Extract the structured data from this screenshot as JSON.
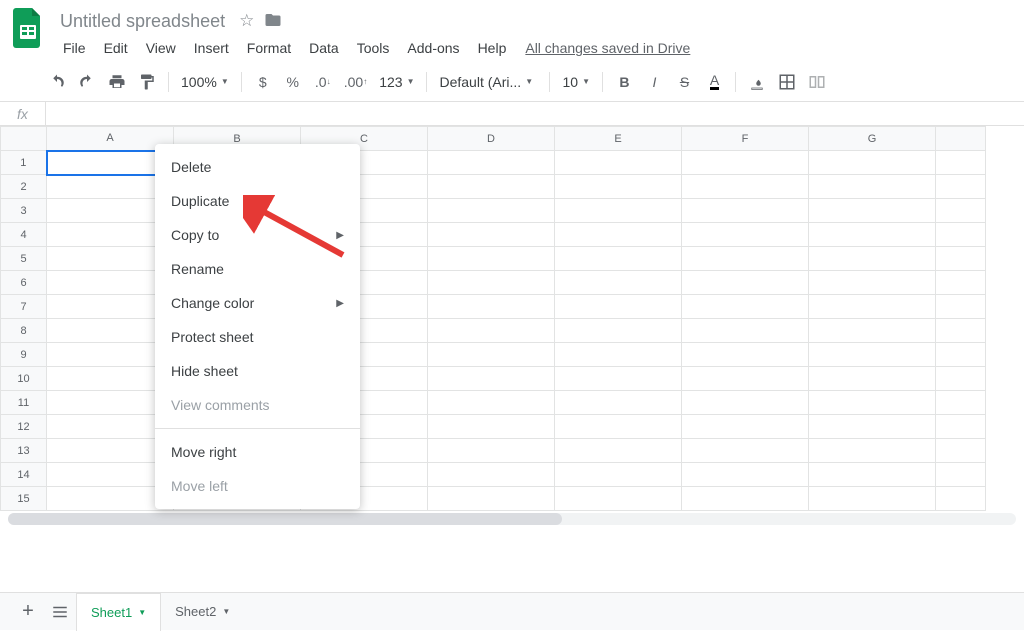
{
  "header": {
    "doc_title": "Untitled spreadsheet",
    "menus": [
      "File",
      "Edit",
      "View",
      "Insert",
      "Format",
      "Data",
      "Tools",
      "Add-ons",
      "Help"
    ],
    "save_status": "All changes saved in Drive"
  },
  "toolbar": {
    "zoom": "100%",
    "currency": "$",
    "percent": "%",
    "dec_down": ".0",
    "dec_up": ".00",
    "num_format": "123",
    "font": "Default (Ari...",
    "font_size": "10",
    "bold": "B",
    "italic": "I",
    "strike": "S",
    "textcolor": "A"
  },
  "formula": {
    "fx": "fx",
    "value": ""
  },
  "grid": {
    "columns": [
      "A",
      "B",
      "C",
      "D",
      "E",
      "F",
      "G"
    ],
    "rows": [
      1,
      2,
      3,
      4,
      5,
      6,
      7,
      8,
      9,
      10,
      11,
      12,
      13,
      14,
      15
    ]
  },
  "sheets": {
    "tabs": [
      {
        "name": "Sheet1",
        "active": true
      },
      {
        "name": "Sheet2",
        "active": false
      }
    ]
  },
  "context_menu": {
    "items": [
      {
        "key": "delete",
        "label": "Delete",
        "submenu": false,
        "disabled": false
      },
      {
        "key": "duplicate",
        "label": "Duplicate",
        "submenu": false,
        "disabled": false
      },
      {
        "key": "copyto",
        "label": "Copy to",
        "submenu": true,
        "disabled": false
      },
      {
        "key": "rename",
        "label": "Rename",
        "submenu": false,
        "disabled": false
      },
      {
        "key": "changecolor",
        "label": "Change color",
        "submenu": true,
        "disabled": false
      },
      {
        "key": "protect",
        "label": "Protect sheet",
        "submenu": false,
        "disabled": false
      },
      {
        "key": "hide",
        "label": "Hide sheet",
        "submenu": false,
        "disabled": false
      },
      {
        "key": "viewcomments",
        "label": "View comments",
        "submenu": false,
        "disabled": true
      },
      {
        "key": "sep"
      },
      {
        "key": "moveright",
        "label": "Move right",
        "submenu": false,
        "disabled": false
      },
      {
        "key": "moveleft",
        "label": "Move left",
        "submenu": false,
        "disabled": true
      }
    ]
  }
}
